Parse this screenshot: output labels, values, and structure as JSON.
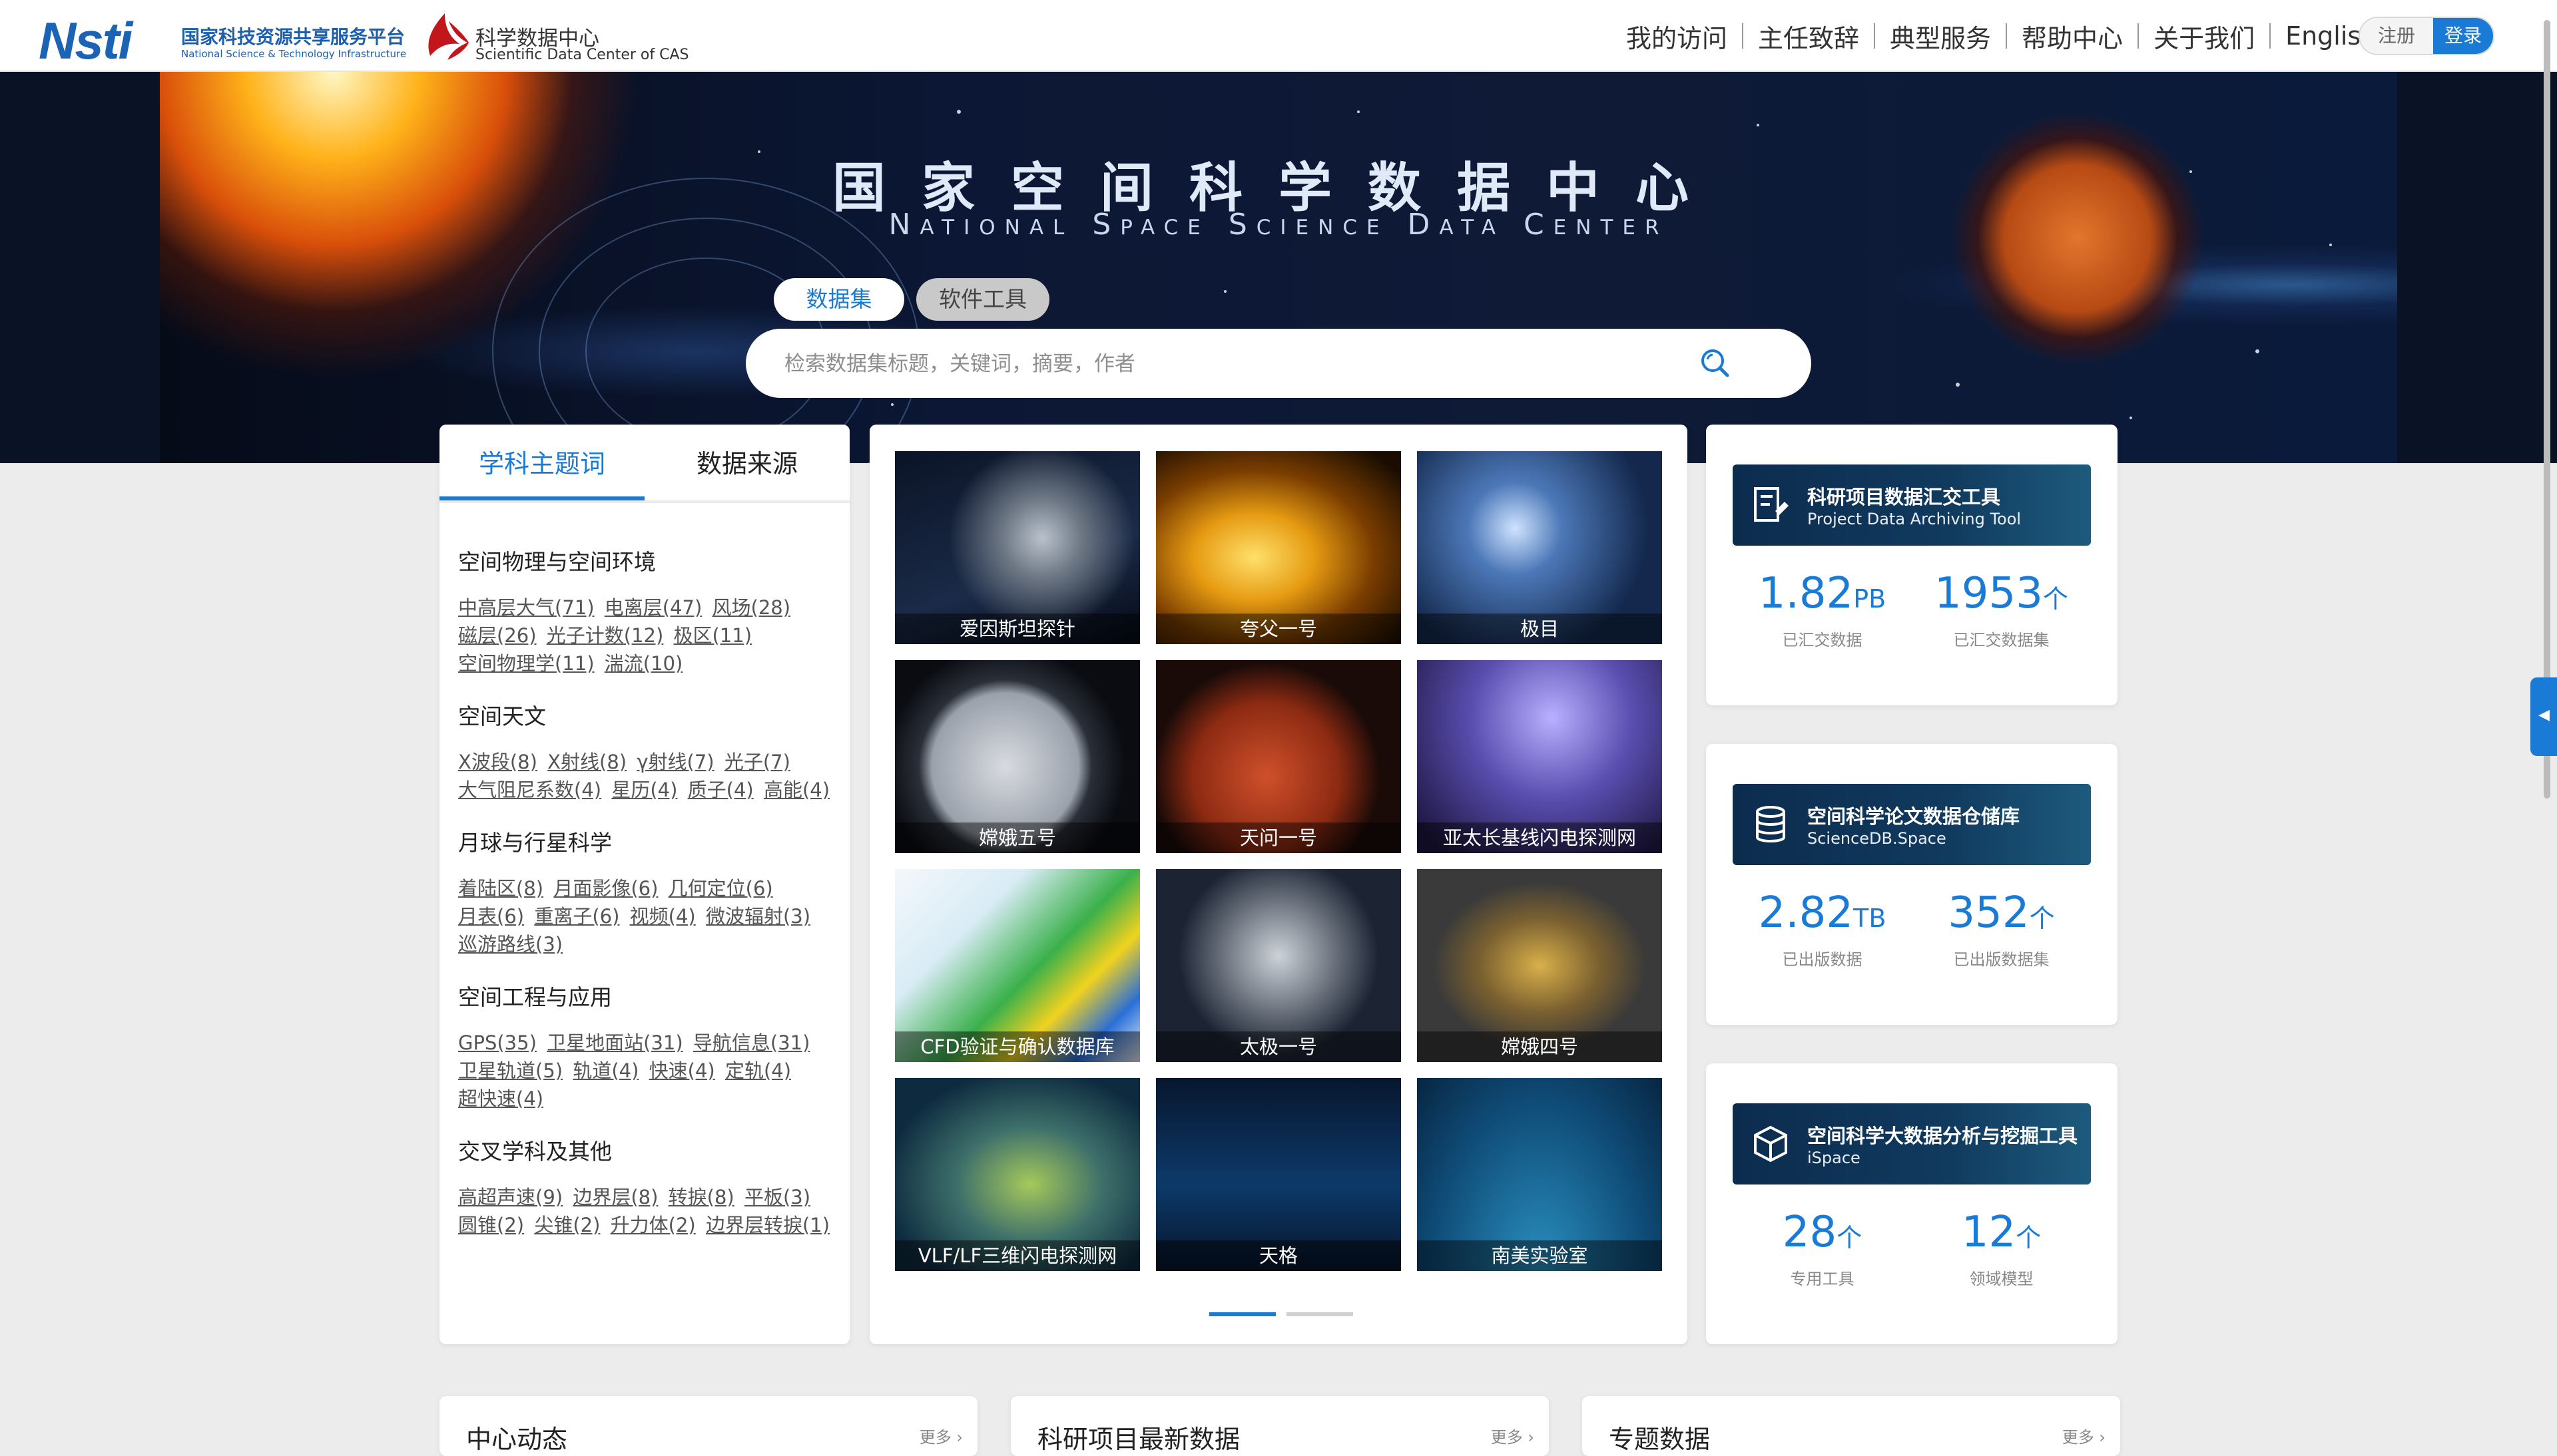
{
  "header": {
    "nsti_mark": "Nsti",
    "nsti_cn": "国家科技资源共享服务平台",
    "nsti_en": "National Science & Technology Infrastructure",
    "cas_cn": "科学数据中心",
    "cas_en": "Scientific Data Center of CAS",
    "nav": [
      "我的访问",
      "主任致辞",
      "典型服务",
      "帮助中心",
      "关于我们",
      "English"
    ],
    "register": "注册",
    "login": "登录"
  },
  "banner": {
    "title_cn": "国家空间科学数据中心",
    "title_en": "National Space Science Data Center",
    "tabs": [
      "数据集",
      "软件工具"
    ],
    "search_placeholder": "检索数据集标题，关键词，摘要，作者"
  },
  "left_panel": {
    "tabs": [
      "学科主题词",
      "数据来源"
    ],
    "topics": [
      {
        "head": "空间物理与空间环境",
        "links": [
          "中高层大气(71)",
          "电离层(47)",
          "风场(28)",
          "磁层(26)",
          "光子计数(12)",
          "极区(11)",
          "空间物理学(11)",
          "湍流(10)"
        ]
      },
      {
        "head": "空间天文",
        "links": [
          "X波段(8)",
          "X射线(8)",
          "γ射线(7)",
          "光子(7)",
          "大气阻尼系数(4)",
          "星历(4)",
          "质子(4)",
          "高能(4)"
        ]
      },
      {
        "head": "月球与行星科学",
        "links": [
          "着陆区(8)",
          "月面影像(6)",
          "几何定位(6)",
          "月表(6)",
          "重离子(6)",
          "视频(4)",
          "微波辐射(3)",
          "巡游路线(3)"
        ]
      },
      {
        "head": "空间工程与应用",
        "links": [
          "GPS(35)",
          "卫星地面站(31)",
          "导航信息(31)",
          "卫星轨道(5)",
          "轨道(4)",
          "快速(4)",
          "定轨(4)",
          "超快速(4)"
        ]
      },
      {
        "head": "交叉学科及其他",
        "links": [
          "高超声速(9)",
          "边界层(8)",
          "转捩(8)",
          "平板(3)",
          "圆锥(2)",
          "尖锥(2)",
          "升力体(2)",
          "边界层转捩(1)"
        ]
      }
    ]
  },
  "tiles": [
    {
      "label": "爱因斯坦探针",
      "art": "satellite"
    },
    {
      "label": "夸父一号",
      "art": "sun"
    },
    {
      "label": "极目",
      "art": "station"
    },
    {
      "label": "嫦娥五号",
      "art": "moon"
    },
    {
      "label": "天问一号",
      "art": "mars"
    },
    {
      "label": "亚太长基线闪电探测网",
      "art": "lightning"
    },
    {
      "label": "CFD验证与确认数据库",
      "art": "cfd"
    },
    {
      "label": "太极一号",
      "art": "cube"
    },
    {
      "label": "嫦娥四号",
      "art": "lander"
    },
    {
      "label": "VLF/LF三维闪电探测网",
      "art": "map"
    },
    {
      "label": "天格",
      "art": "wave"
    },
    {
      "label": "南美实验室",
      "art": "earth"
    }
  ],
  "stats": [
    {
      "title_cn": "科研项目数据汇交工具",
      "title_en": "Project Data Archiving Tool",
      "icon": "archive-icon",
      "figs": [
        {
          "value": "1.82",
          "unit": "PB",
          "label": "已汇交数据"
        },
        {
          "value": "1953",
          "unit": "个",
          "label": "已汇交数据集"
        }
      ]
    },
    {
      "title_cn": "空间科学论文数据仓储库",
      "title_en": "ScienceDB.Space",
      "icon": "database-icon",
      "figs": [
        {
          "value": "2.82",
          "unit": "TB",
          "label": "已出版数据"
        },
        {
          "value": "352",
          "unit": "个",
          "label": "已出版数据集"
        }
      ]
    },
    {
      "title_cn": "空间科学大数据分析与挖掘工具",
      "title_en": "iSpace",
      "icon": "cube-icon",
      "figs": [
        {
          "value": "28",
          "unit": "个",
          "label": "专用工具"
        },
        {
          "value": "12",
          "unit": "个",
          "label": "领域模型"
        }
      ]
    }
  ],
  "bottom": [
    {
      "title": "中心动态",
      "more": "更多 ›"
    },
    {
      "title": "科研项目最新数据",
      "more": "更多 ›"
    },
    {
      "title": "专题数据",
      "more": "更多 ›"
    }
  ],
  "colors": {
    "accent": "#1a7bd6",
    "page_bg": "#ececec"
  }
}
